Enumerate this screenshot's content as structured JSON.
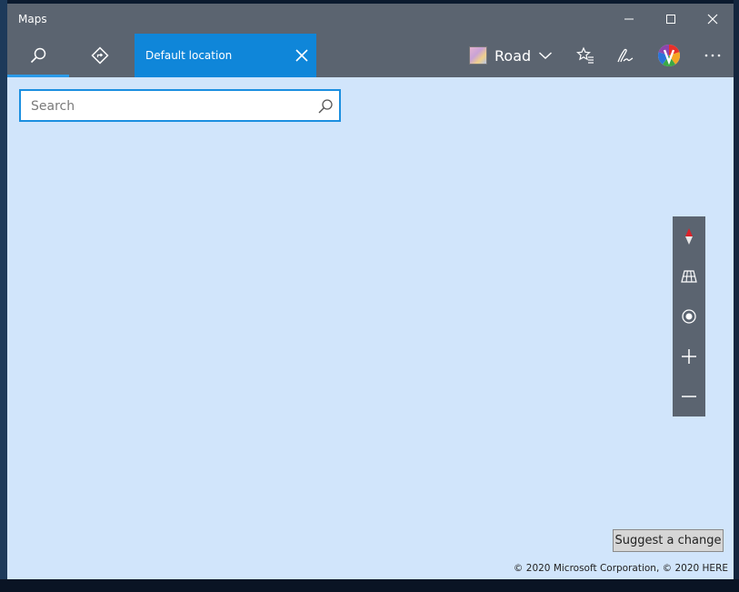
{
  "window": {
    "title": "Maps"
  },
  "toolbar": {
    "location_tab_label": "Default location",
    "map_style_label": "Road"
  },
  "search": {
    "placeholder": "Search",
    "value": ""
  },
  "footer": {
    "suggest_label": "Suggest a change",
    "copyright": "© 2020 Microsoft Corporation, © 2020 HERE"
  },
  "colors": {
    "accent": "#0f86d9",
    "chrome": "#5b6470",
    "map_background": "#d1e5fb"
  },
  "icons": {
    "toolbar": [
      "search-icon",
      "directions-icon",
      "close-icon",
      "chevron-down-icon",
      "favorites-icon",
      "ink-pen-icon",
      "profile-avatar",
      "more-icon"
    ],
    "map_controls": [
      "compass-icon",
      "tilt-3d-icon",
      "my-location-icon",
      "zoom-in-icon",
      "zoom-out-icon"
    ],
    "window_controls": [
      "minimize-icon",
      "maximize-icon",
      "close-icon"
    ]
  }
}
